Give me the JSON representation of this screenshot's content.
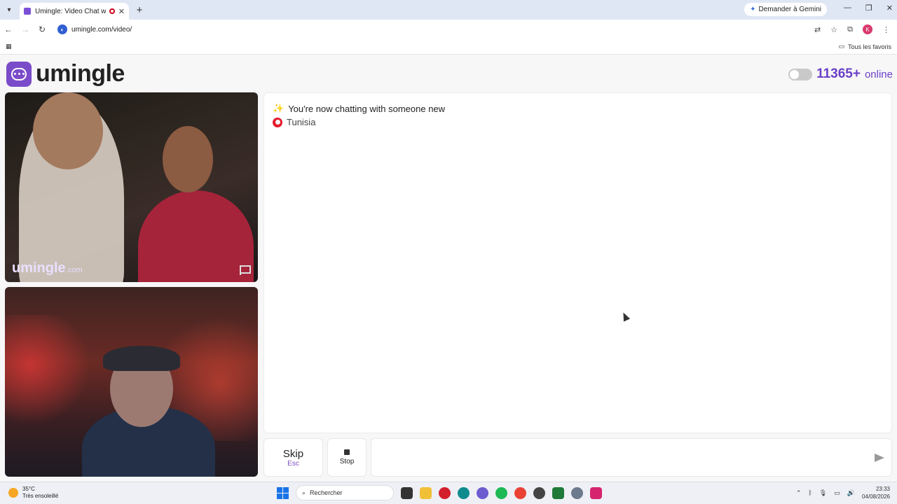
{
  "browser": {
    "tab_title": "Umingle: Video Chat with S",
    "tab_close": "✕",
    "new_tab": "+",
    "url": "umingle.com/video/",
    "gemini_label": "Demander à Gemini",
    "bookmarks_label": "Tous les favoris",
    "avatar_letter": "K"
  },
  "site": {
    "logo_text": "umingle",
    "online_count": "11365+",
    "online_label": "online",
    "watermark": "umingle",
    "watermark_suffix": ".com"
  },
  "chat": {
    "status_message": "You're now chatting with someone new",
    "country": "Tunisia",
    "input_value": ""
  },
  "controls": {
    "skip_label": "Skip",
    "skip_shortcut": "Esc",
    "stop_label": "Stop"
  },
  "taskbar": {
    "temperature": "35°C",
    "weather": "Très ensoleillé",
    "search_label": "Rechercher",
    "time": "23:33",
    "date": "04/08/2026"
  },
  "colors": {
    "brand": "#7b4cc9",
    "online": "#6a3fc7"
  }
}
